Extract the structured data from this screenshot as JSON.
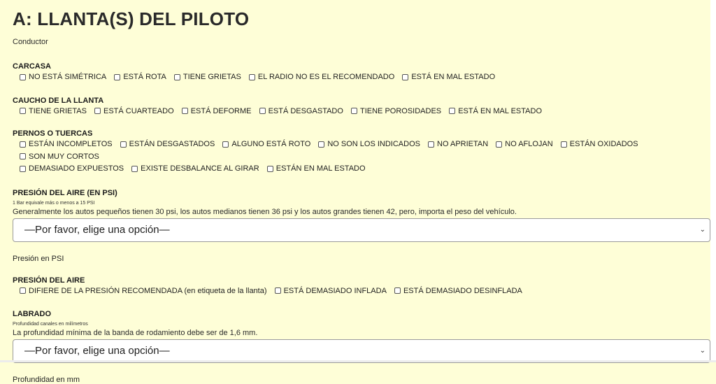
{
  "header": {
    "title": "A: LLANTA(S) DEL PILOTO",
    "subtitle": "Conductor"
  },
  "carcasa": {
    "title": "CARCASA",
    "options": [
      "NO ESTÁ SIMÉTRICA",
      "ESTÁ ROTA",
      "TIENE GRIETAS",
      "EL RADIO NO ES EL RECOMENDADO",
      "ESTÁ EN MAL ESTADO"
    ]
  },
  "caucho": {
    "title": "CAUCHO DE LA LLANTA",
    "options": [
      "TIENE GRIETAS",
      "ESTÁ CUARTEADO",
      "ESTÁ DEFORME",
      "ESTÁ DESGASTADO",
      "TIENE POROSIDADES",
      "ESTÁ EN MAL ESTADO"
    ]
  },
  "pernos": {
    "title": "PERNOS O TUERCAS",
    "options_row1": [
      "ESTÁN INCOMPLETOS",
      "ESTÁN DESGASTADOS",
      "ALGUNO ESTÁ ROTO",
      "NO SON LOS INDICADOS",
      "NO APRIETAN",
      "NO AFLOJAN",
      "ESTÁN OXIDADOS",
      "SON MUY CORTOS"
    ],
    "options_row2": [
      "DEMASIADO EXPUESTOS",
      "EXISTE DESBALANCE AL GIRAR",
      "ESTÁN EN MAL ESTADO"
    ]
  },
  "presion_psi": {
    "title": "PRESIÓN DEL AIRE (EN PSI)",
    "small_note": "1 Bar equivale más o menos a 15 PSI",
    "note": "Generalmente los autos pequeños tienen 30 psi, los autos medianos tienen 36 psi y los autos grandes tienen 42, pero, importa el peso del vehículo.",
    "select_value": "—Por favor, elige una opción—",
    "label": "Presión en PSI"
  },
  "presion_aire": {
    "title": "PRESIÓN DEL AIRE",
    "options": [
      "DIFIERE DE LA PRESIÓN RECOMENDADA (en etiqueta de la llanta)",
      "ESTÁ DEMASIADO INFLADA",
      "ESTÁ DEMASIADO DESINFLADA"
    ]
  },
  "labrado": {
    "title": "LABRADO",
    "small_note": "Profundidad canales en milímetros",
    "note": "La profundidad mínima de la banda de rodamiento debe ser de 1,6 mm.",
    "select_value": "—Por favor, elige una opción—",
    "label": "Profundidad en mm"
  },
  "icons": {
    "checkbox": "checkbox-icon",
    "select_arrow": "chevron-down-icon"
  },
  "colors": {
    "background": "#fefed7",
    "text": "#1f1f1f"
  }
}
